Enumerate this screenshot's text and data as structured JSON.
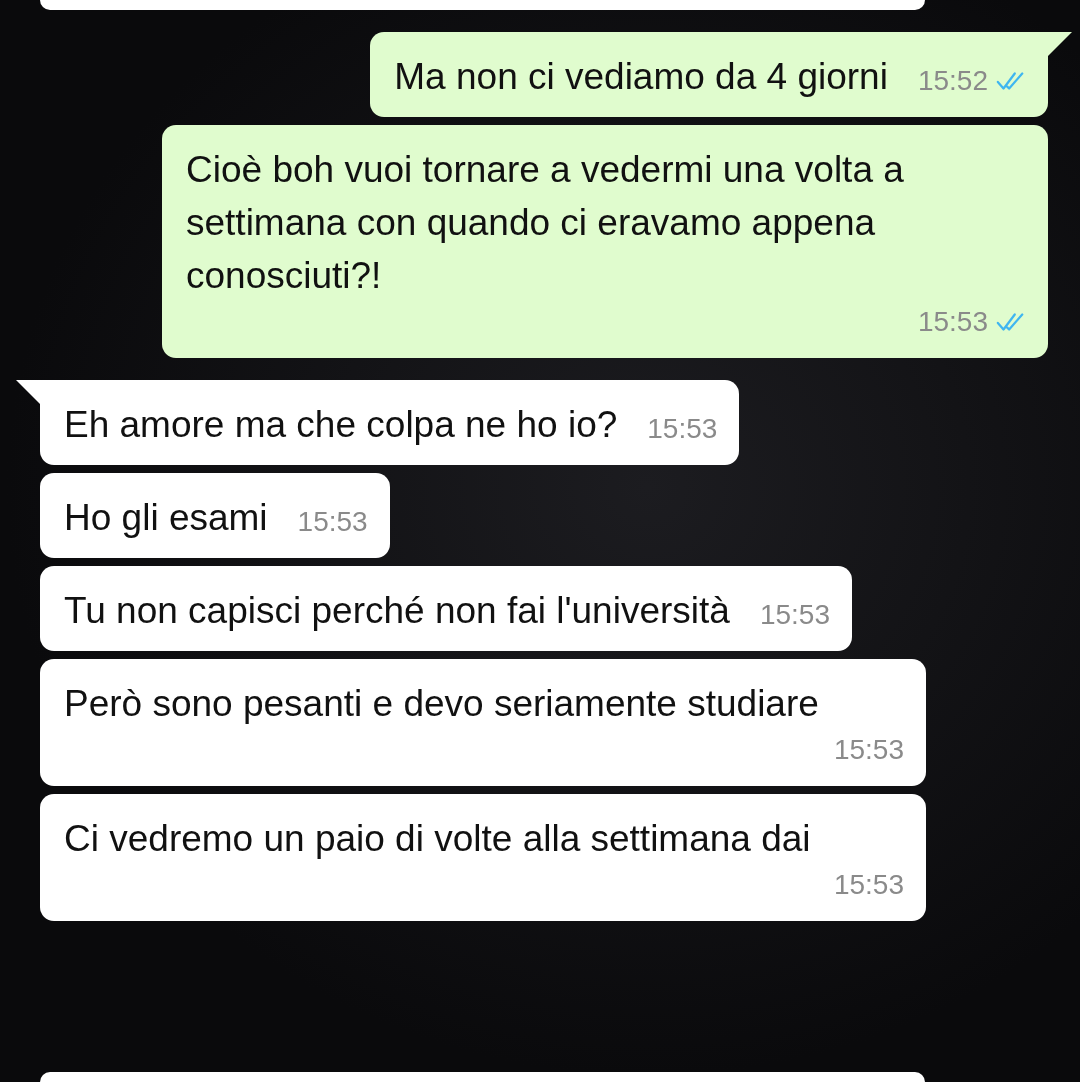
{
  "messages": [
    {
      "kind": "out",
      "tail": true,
      "text": "Ma non ci vediamo da 4 giorni",
      "time": "15:52",
      "read": true
    },
    {
      "kind": "out",
      "tail": false,
      "text": "Cioè boh vuoi tornare a vedermi una volta a settimana con quando ci eravamo appena conosciuti?!",
      "time": "15:53",
      "read": true
    },
    {
      "kind": "in",
      "tail": true,
      "text": "Eh amore ma che colpa ne ho io?",
      "time": "15:53"
    },
    {
      "kind": "in",
      "tail": false,
      "text": "Ho gli esami",
      "time": "15:53"
    },
    {
      "kind": "in",
      "tail": false,
      "text": "Tu non capisci perché non fai l'università",
      "time": "15:53"
    },
    {
      "kind": "in",
      "tail": false,
      "text": "Però sono pesanti e devo seriamente studiare",
      "time": "15:53"
    },
    {
      "kind": "in",
      "tail": false,
      "text": "Ci vedremo un paio di volte alla settimana dai",
      "time": "15:53"
    }
  ]
}
